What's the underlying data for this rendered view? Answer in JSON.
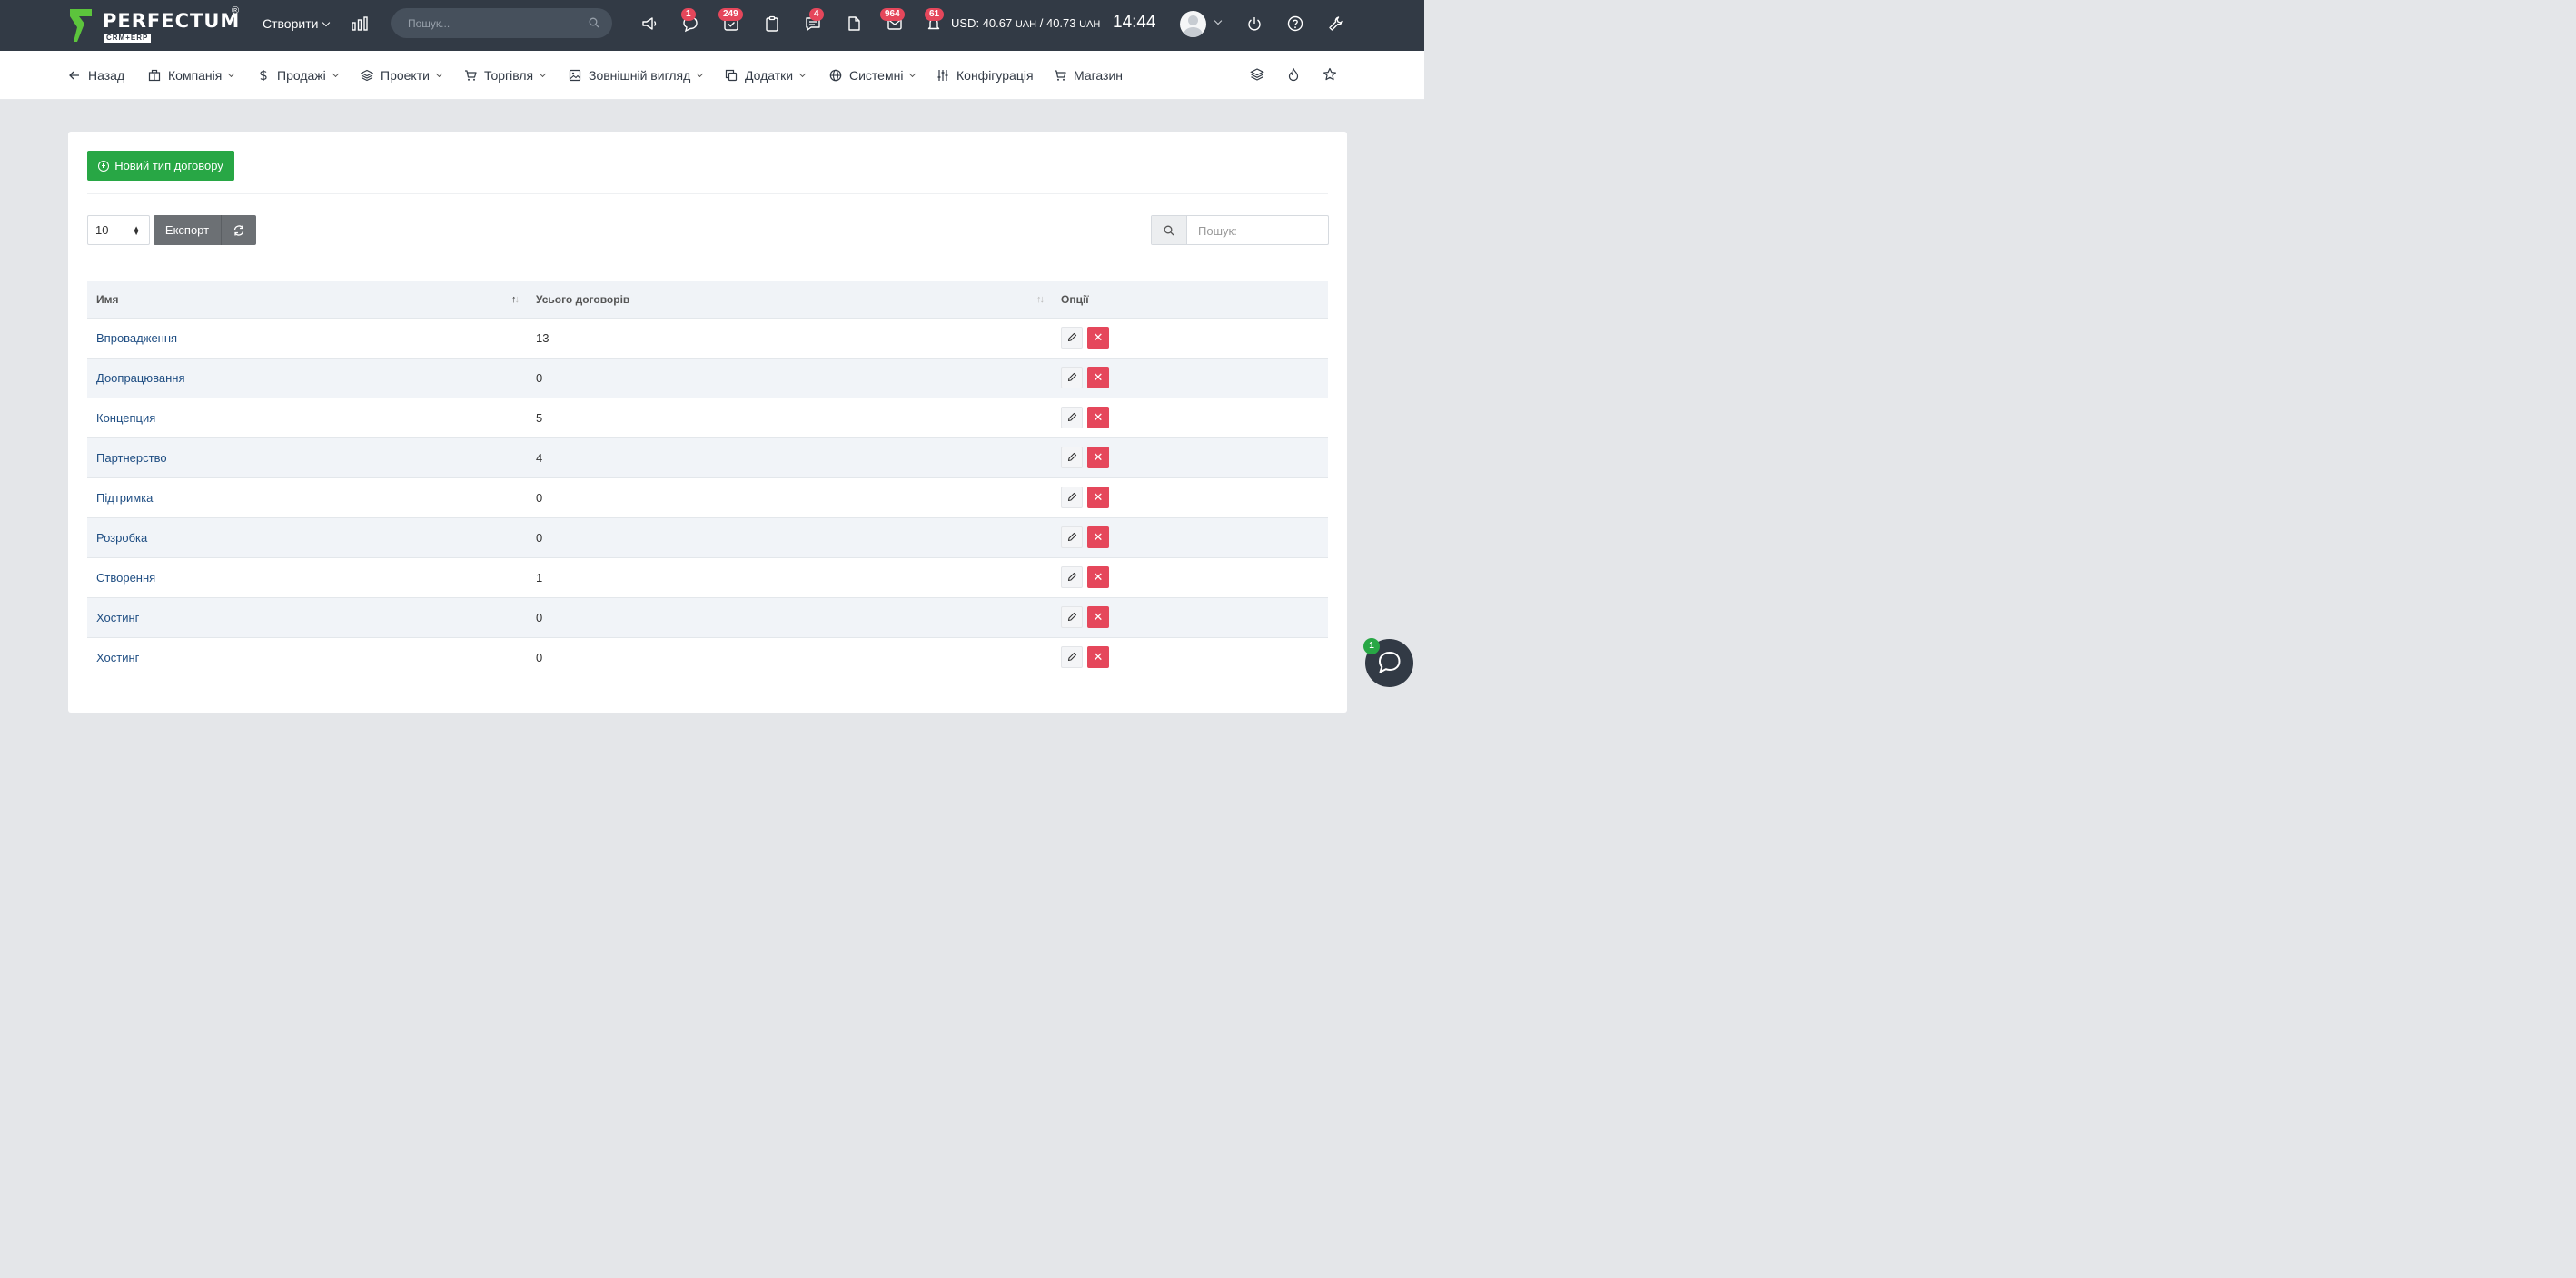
{
  "brand": {
    "name": "PERFECTUM",
    "sub": "CRM+ERP",
    "reg": "®"
  },
  "topbar": {
    "create_label": "Створити",
    "search_placeholder": "Пошук...",
    "badges": {
      "chat": "1",
      "tasks": "249",
      "messages": "4",
      "mail": "964",
      "notifications": "61"
    },
    "rates": {
      "usd_label": "USD:",
      "buy": "40.67",
      "sell": "40.73",
      "currency": "UAH",
      "separator": "/"
    },
    "clock": "14:44"
  },
  "menu": {
    "back": "Назад",
    "company": "Компанія",
    "sales": "Продажі",
    "projects": "Проекти",
    "trade": "Торгівля",
    "appearance": "Зовнішній вигляд",
    "addons": "Додатки",
    "system": "Системні",
    "config": "Конфігурація",
    "shop": "Магазин"
  },
  "page": {
    "new_button": "Новий тип договору",
    "page_length": "10",
    "export_label": "Експорт",
    "search_placeholder": "Пошук:"
  },
  "table": {
    "columns": {
      "name": "Имя",
      "total": "Усього договорів",
      "options": "Опції"
    },
    "rows": [
      {
        "name": "Впровадження",
        "total": "13"
      },
      {
        "name": "Доопрацювання",
        "total": "0"
      },
      {
        "name": "Концепция",
        "total": "5"
      },
      {
        "name": "Партнерство",
        "total": "4"
      },
      {
        "name": "Підтримка",
        "total": "0"
      },
      {
        "name": "Розробка",
        "total": "0"
      },
      {
        "name": "Створення",
        "total": "1"
      },
      {
        "name": "Хостинг",
        "total": "0"
      },
      {
        "name": "Хостинг",
        "total": "0"
      }
    ]
  },
  "chat": {
    "badge": "1"
  },
  "colors": {
    "topbar": "#323a45",
    "green": "#28a745",
    "danger": "#e5475b",
    "link": "#1e4d82"
  }
}
